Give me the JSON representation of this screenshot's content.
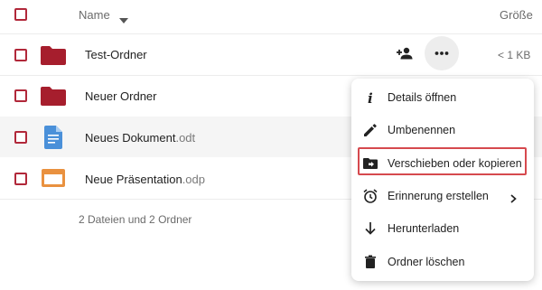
{
  "header": {
    "name_label": "Name",
    "size_label": "Größe"
  },
  "files": [
    {
      "name": "Test-Ordner",
      "ext": "",
      "size": "< 1 KB",
      "type": "folder"
    },
    {
      "name": "Neuer Ordner",
      "ext": "",
      "size": "",
      "type": "folder"
    },
    {
      "name": "Neues Dokument",
      "ext": ".odt",
      "size": "",
      "type": "document"
    },
    {
      "name": "Neue Präsentation",
      "ext": ".odp",
      "size": "",
      "type": "presentation"
    }
  ],
  "summary": "2 Dateien und 2 Ordner",
  "menu": {
    "items": [
      {
        "label": "Details öffnen",
        "icon": "info-icon"
      },
      {
        "label": "Umbenennen",
        "icon": "pencil-icon"
      },
      {
        "label": "Verschieben oder kopieren",
        "icon": "folder-move-icon"
      },
      {
        "label": "Erinnerung erstellen",
        "icon": "alarm-clock-icon"
      },
      {
        "label": "Herunterladen",
        "icon": "download-arrow-icon"
      },
      {
        "label": "Ordner löschen",
        "icon": "trash-icon"
      }
    ]
  },
  "colors": {
    "checkbox": "#b1283a",
    "folder": "#a61e2d",
    "document": "#4a90d9",
    "presentation": "#e9913f",
    "highlight": "#d6494e",
    "row_hover": "#f5f5f5"
  }
}
